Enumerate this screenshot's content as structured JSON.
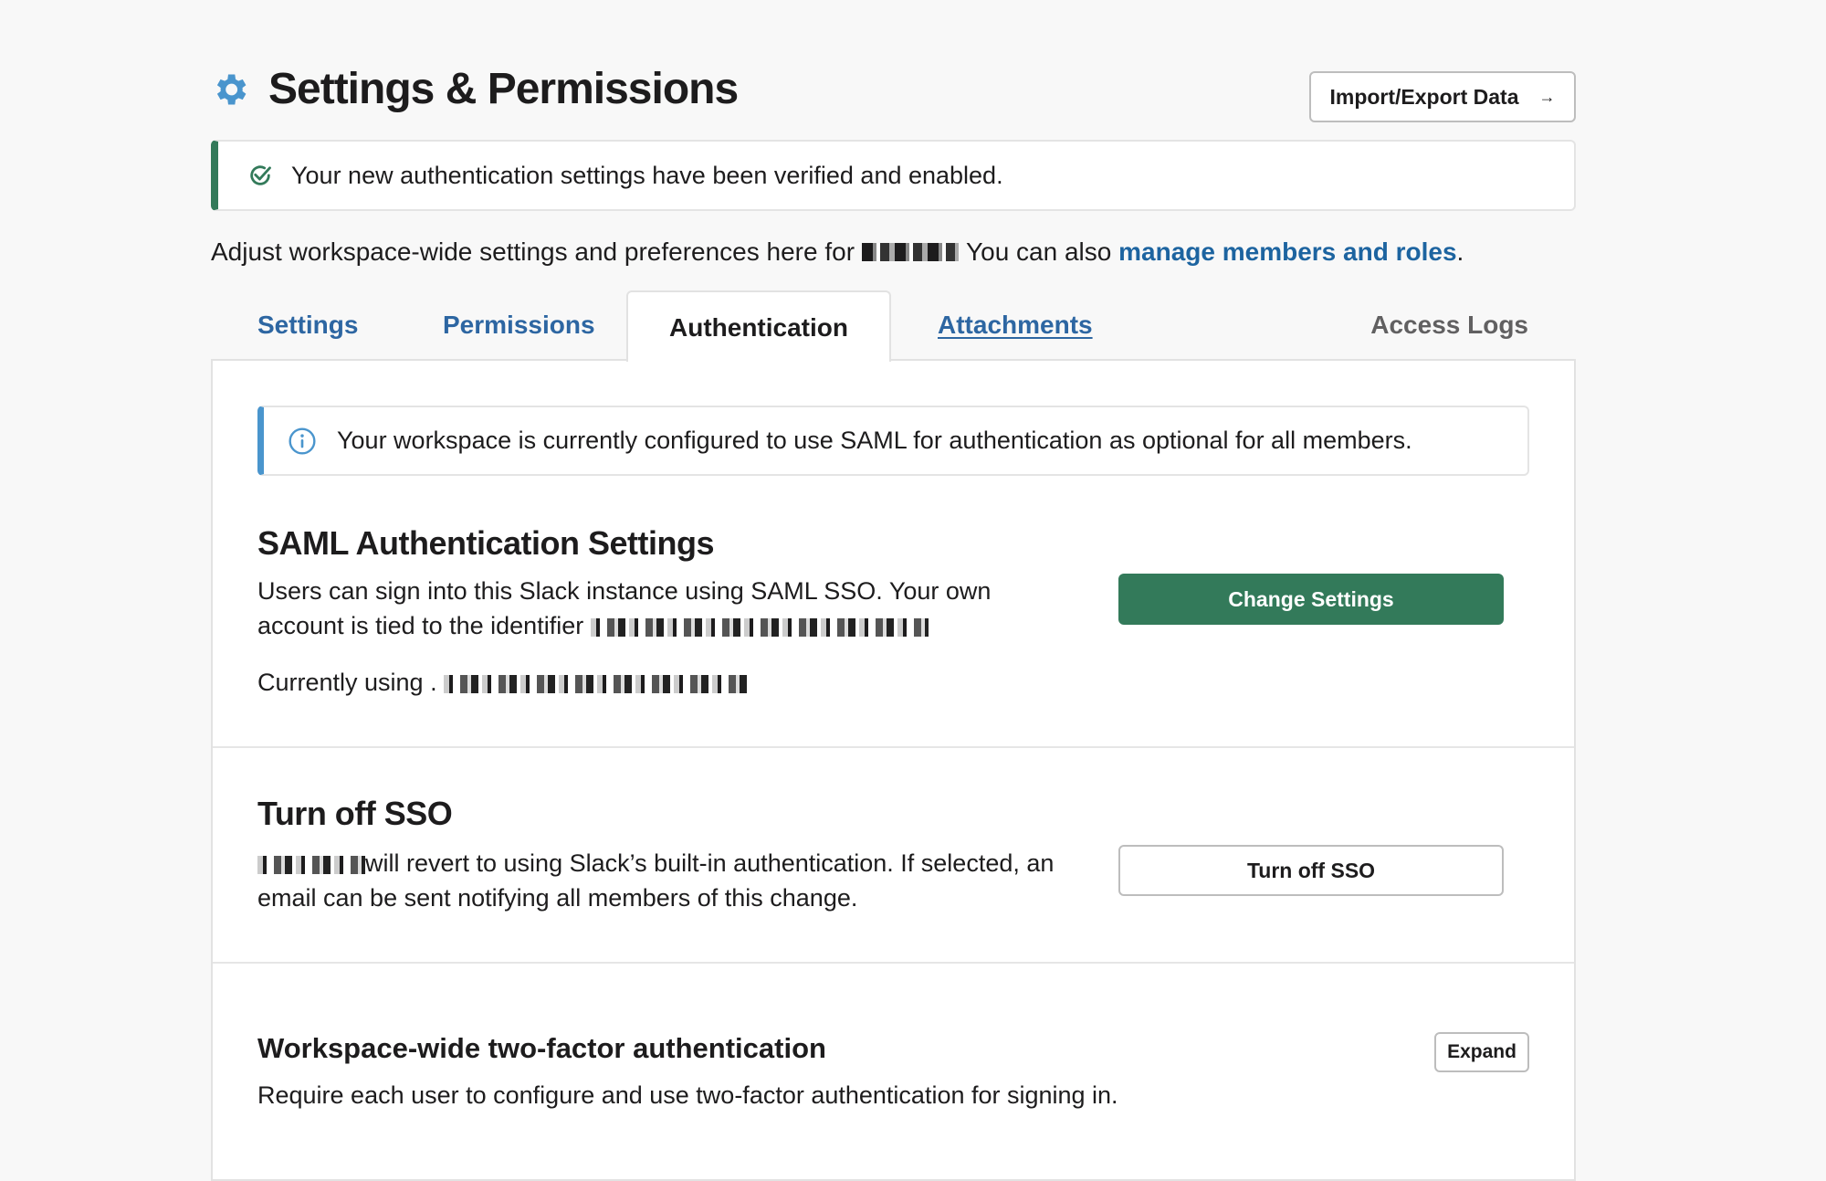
{
  "header": {
    "icon": "gear-icon",
    "title": "Settings & Permissions",
    "import_export_label": "Import/Export Data",
    "import_export_icon": "arrow-right-icon",
    "accent_color": "#4a95cd"
  },
  "success_banner": {
    "icon": "check-circle-icon",
    "text": "Your new authentication settings have been verified and enabled.",
    "color": "#337a5a"
  },
  "description": {
    "prefix": "Adjust workspace-wide settings and preferences here for",
    "middle": "You can also",
    "link": "manage members and roles",
    "suffix": "."
  },
  "tabs": [
    {
      "label": "Settings",
      "active": false
    },
    {
      "label": "Permissions",
      "active": false
    },
    {
      "label": "Authentication",
      "active": true
    },
    {
      "label": "Attachments",
      "active": false
    },
    {
      "label": "Access Logs",
      "active": false
    }
  ],
  "info_banner": {
    "icon": "info-icon",
    "text": "Your workspace is currently configured to use SAML for authentication as optional for all members.",
    "color": "#4a95cd"
  },
  "saml": {
    "title": "SAML Authentication Settings",
    "line1": "Users can sign into this Slack instance using SAML SSO. Your own",
    "line2": "account is tied to the identifier",
    "currently_using": "Currently using .",
    "button_label": "Change Settings",
    "button_color": "#337a5a"
  },
  "turn_off_sso": {
    "title": "Turn off SSO",
    "line1": "will revert to using Slack’s built-in authentication. If selected, an",
    "line2": "email can be sent notifying all members of this change.",
    "button_label": "Turn off SSO"
  },
  "two_factor": {
    "title": "Workspace-wide two-factor authentication",
    "description": "Require each user to configure and use two-factor authentication for signing in.",
    "button_label": "Expand"
  }
}
